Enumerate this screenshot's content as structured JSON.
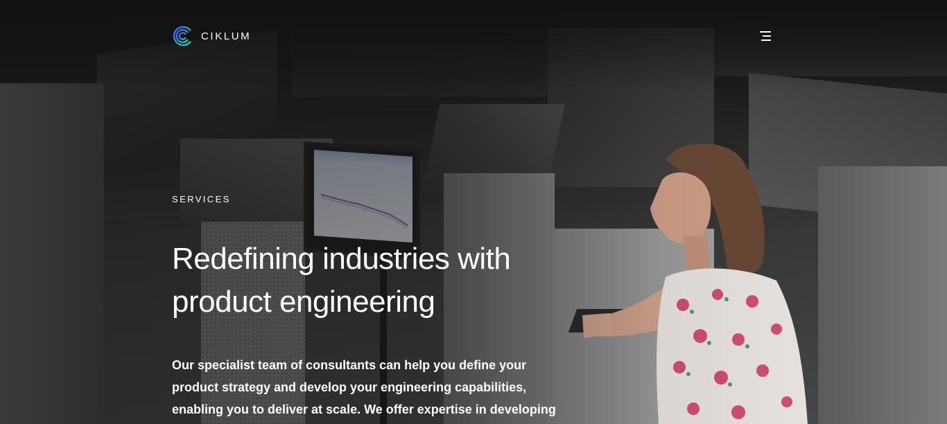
{
  "brand": {
    "name": "CIKLUM",
    "logo_colors": [
      "#3f5dff",
      "#2cd6a0"
    ]
  },
  "header": {
    "menu_icon": "hamburger-menu-icon"
  },
  "hero": {
    "eyebrow": "SERVICES",
    "headline_line1": "Redefining industries with",
    "headline_line2": "product engineering",
    "body": "Our specialist team of consultants can help you define your product strategy and develop your engineering capabilities, enabling you to deliver at scale. We offer expertise in developing custom products and platforms that meet the"
  },
  "colors": {
    "background": "#1a1919",
    "text": "#ffffff"
  }
}
